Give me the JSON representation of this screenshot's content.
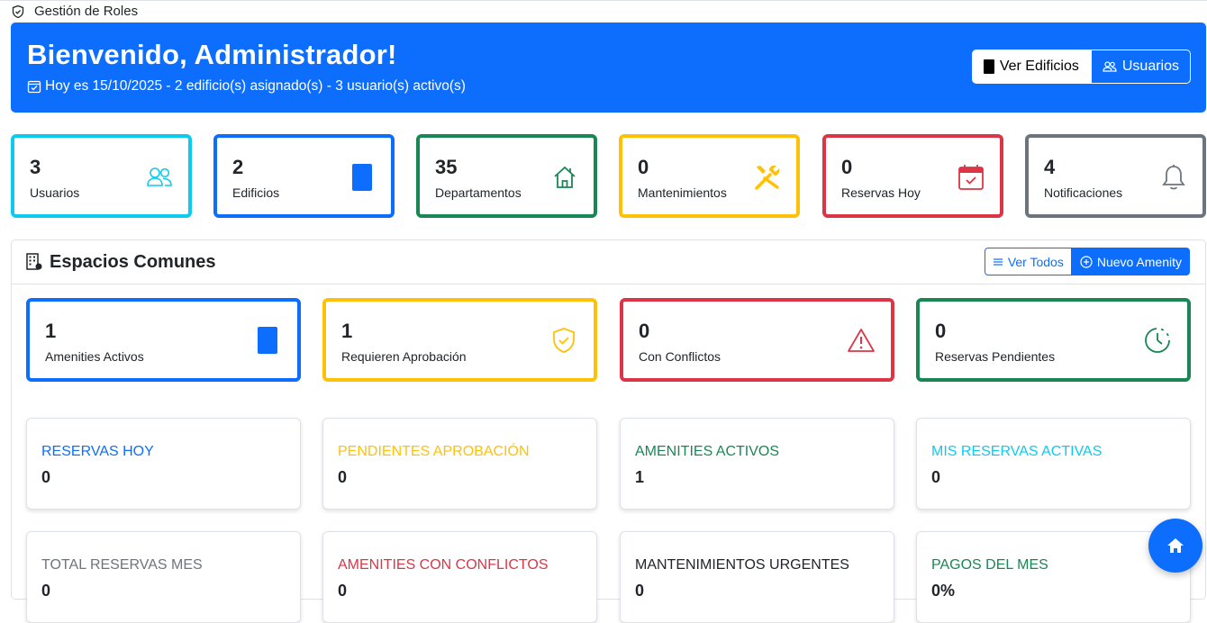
{
  "topbar": {
    "title": "Gestión de Roles"
  },
  "hero": {
    "title": "Bienvenido, Administrador!",
    "subtitle": "Hoy es 15/10/2025 - 2 edificio(s) asignado(s) - 3 usuario(s) activo(s)",
    "btn_buildings": "Ver Edificios",
    "btn_users": "Usuarios"
  },
  "stats": [
    {
      "value": "3",
      "label": "Usuarios",
      "color": "#0dcaf0",
      "icon": "people-icon"
    },
    {
      "value": "2",
      "label": "Edificios",
      "color": "#0d6efd",
      "icon": "building-icon"
    },
    {
      "value": "35",
      "label": "Departamentos",
      "color": "#198754",
      "icon": "house-icon"
    },
    {
      "value": "0",
      "label": "Mantenimientos",
      "color": "#ffc107",
      "icon": "tools-icon"
    },
    {
      "value": "0",
      "label": "Reservas Hoy",
      "color": "#dc3545",
      "icon": "calendar-check-icon"
    },
    {
      "value": "4",
      "label": "Notificaciones",
      "color": "#6c757d",
      "icon": "bell-icon"
    }
  ],
  "panel": {
    "title": "Espacios Comunes",
    "btn_view_all": "Ver Todos",
    "btn_new": "Nuevo Amenity"
  },
  "amenity_stats": [
    {
      "value": "1",
      "label": "Amenities Activos",
      "color": "#0d6efd",
      "icon": "building-icon"
    },
    {
      "value": "1",
      "label": "Requieren Aprobación",
      "color": "#ffc107",
      "icon": "shield-check-icon"
    },
    {
      "value": "0",
      "label": "Con Conflictos",
      "color": "#dc3545",
      "icon": "warning-icon"
    },
    {
      "value": "0",
      "label": "Reservas Pendientes",
      "color": "#198754",
      "icon": "clock-icon"
    }
  ],
  "cards": [
    {
      "title": "Reservas Hoy",
      "value": "0",
      "color": "#0d6efd"
    },
    {
      "title": "Pendientes Aprobación",
      "value": "0",
      "color": "#ffc107"
    },
    {
      "title": "Amenities Activos",
      "value": "1",
      "color": "#198754"
    },
    {
      "title": "Mis Reservas Activas",
      "value": "0",
      "color": "#0dcaf0"
    },
    {
      "title": "Total Reservas Mes",
      "value": "0",
      "color": "#6c757d"
    },
    {
      "title": "Amenities con Conflictos",
      "value": "0",
      "color": "#dc3545"
    },
    {
      "title": "Mantenimientos Urgentes",
      "value": "0",
      "color": "#212529"
    },
    {
      "title": "Pagos del Mes",
      "value": "0%",
      "color": "#198754"
    }
  ],
  "fab": {
    "icon": "house-icon"
  }
}
